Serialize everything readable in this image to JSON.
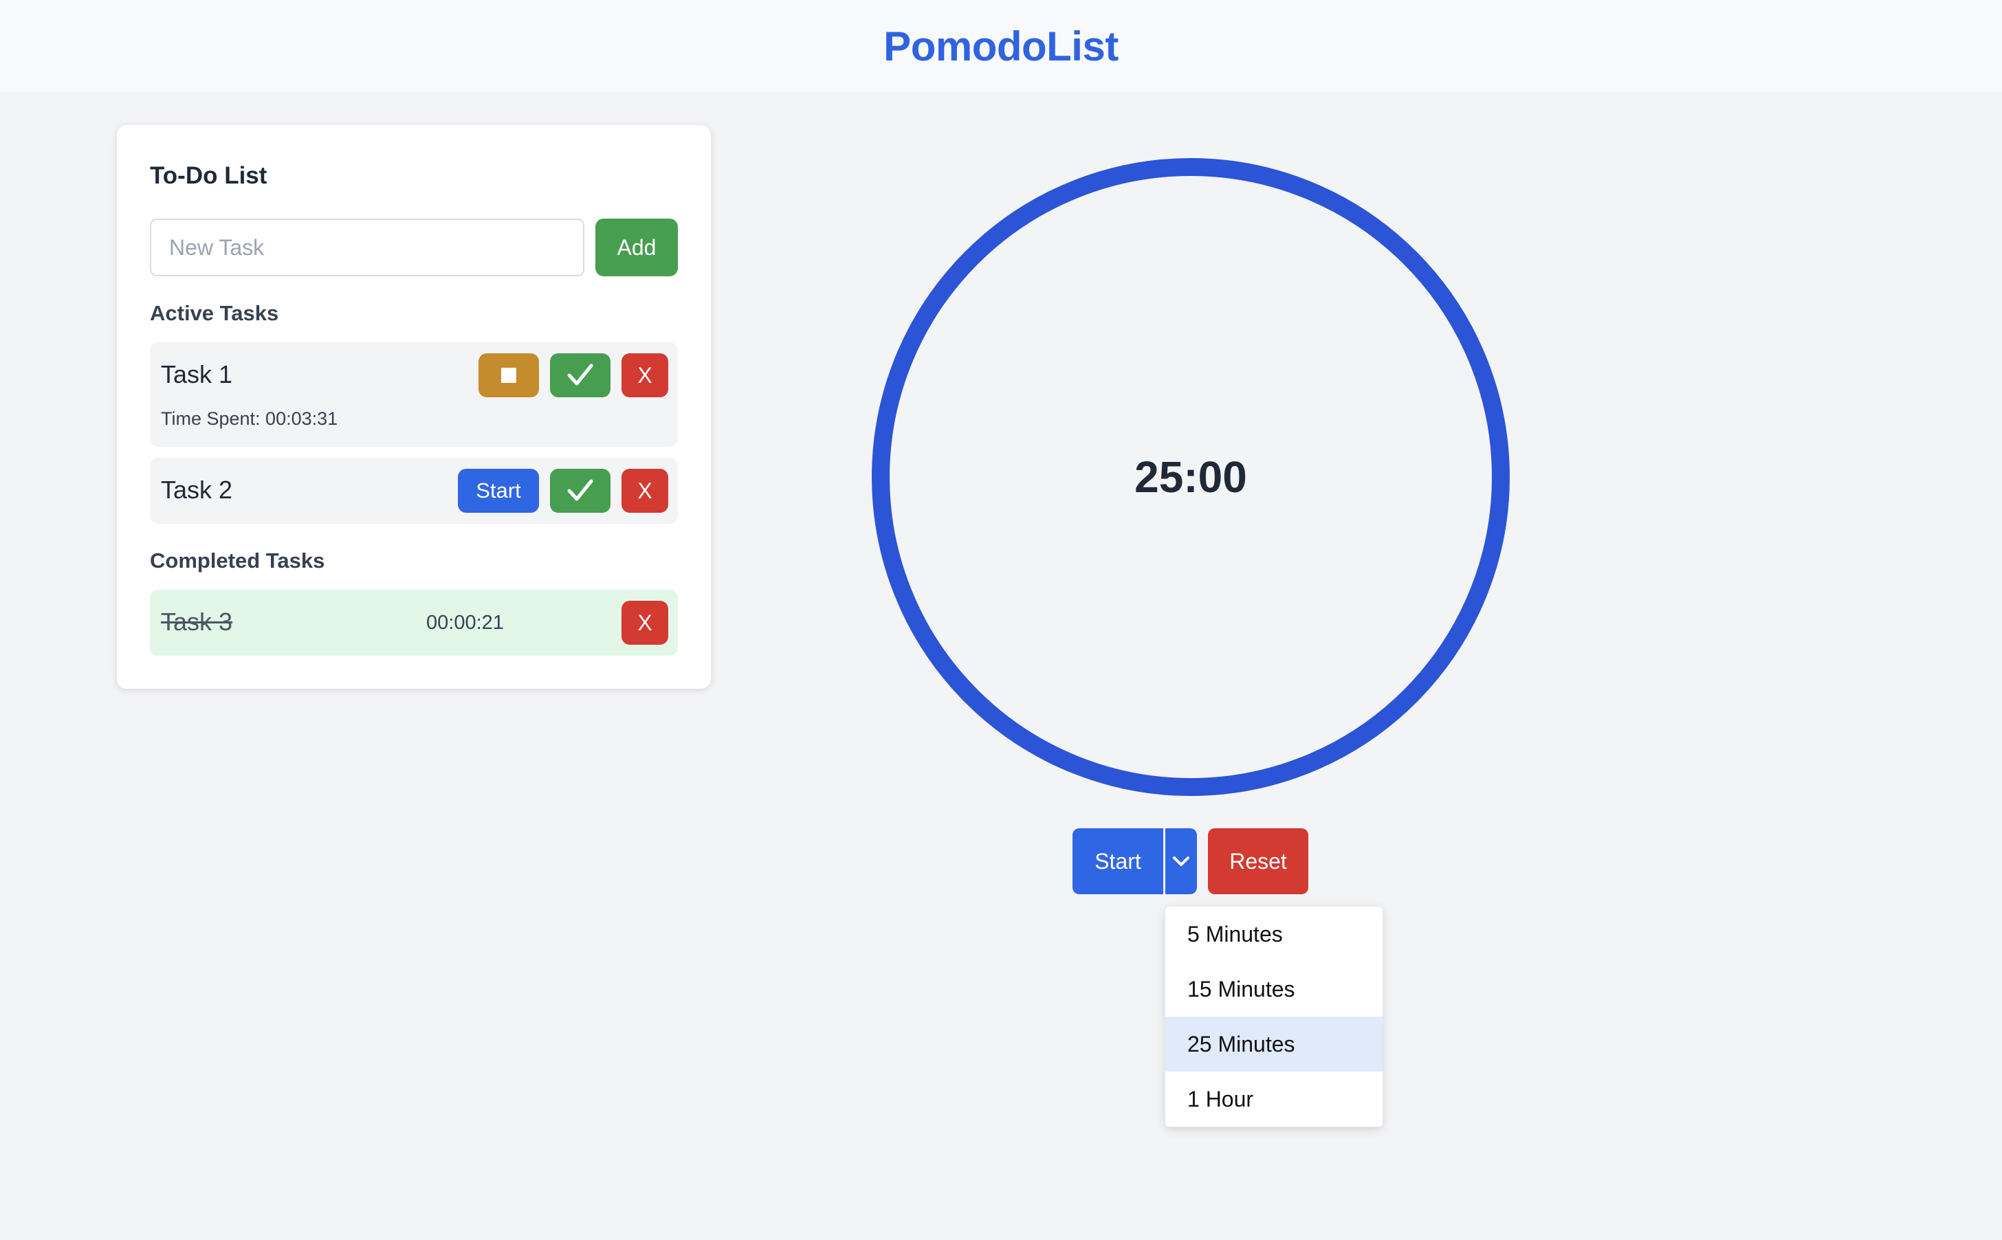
{
  "header": {
    "title": "PomodoList"
  },
  "todo": {
    "title": "To-Do List",
    "input_placeholder": "New Task",
    "input_value": "",
    "add_label": "Add",
    "active_heading": "Active Tasks",
    "completed_heading": "Completed Tasks",
    "active_tasks": [
      {
        "name": "Task 1",
        "running": true,
        "time_spent": "Time Spent: 00:03:31",
        "delete_label": "X"
      },
      {
        "name": "Task 2",
        "running": false,
        "start_label": "Start",
        "delete_label": "X"
      }
    ],
    "completed_tasks": [
      {
        "name": "Task 3",
        "time": "00:00:21",
        "delete_label": "X"
      }
    ]
  },
  "timer": {
    "display": "25:00",
    "start_label": "Start",
    "reset_label": "Reset",
    "duration_options": [
      "5 Minutes",
      "15 Minutes",
      "25 Minutes",
      "1 Hour"
    ],
    "selected_option": "25 Minutes"
  },
  "colors": {
    "brand": "#2f63e0",
    "ring": "#2b54d6",
    "start": "#2f66e4",
    "success": "#479e50",
    "danger": "#d23a32",
    "warning": "#c48c2c",
    "completed_bg": "#e2f7e8"
  },
  "icons": {
    "stop": "stop-square-icon",
    "complete": "checkmark-icon",
    "dropdown": "chevron-down-icon"
  }
}
